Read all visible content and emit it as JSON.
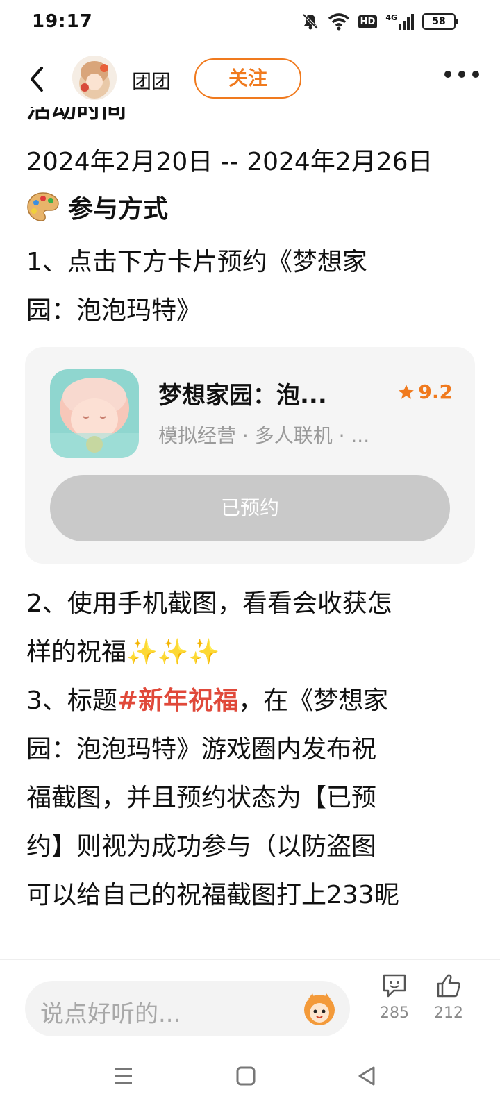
{
  "status_bar": {
    "time": "19:17",
    "battery": "58",
    "network": "4G",
    "hd": "HD"
  },
  "nav": {
    "username": "团团",
    "follow_label": "关注"
  },
  "article": {
    "clipped_heading": "活动时间",
    "date_range": "2024年2月20日 -- 2024年2月26日",
    "section_title": "参与方式",
    "step1_line1": "1、点击下方卡片预约《梦想家",
    "step1_line2": "园：泡泡玛特》",
    "step2_line1": "2、使用手机截图，看看会收获怎",
    "step2_line2": "样的祝福",
    "sparkles": "✨✨✨",
    "step3_prefix": "3、标题",
    "step3_hashtag": "#新年祝福",
    "step3_suffix": "，在《梦想家",
    "step3_line2": "园：泡泡玛特》游戏圈内发布祝",
    "step3_line3": "福截图，并且预约状态为【已预",
    "step3_line4": "约】则视为成功参与（以防盗图",
    "step3_line5": "可以给自己的祝福截图打上233昵"
  },
  "game_card": {
    "title": "梦想家园：泡...",
    "rating": "9.2",
    "tags": "模拟经营 · 多人联机 · ...",
    "reserved_label": "已预约"
  },
  "bottom_bar": {
    "comment_placeholder": "说点好听的...",
    "comment_count": "285",
    "like_count": "212"
  },
  "colors": {
    "accent": "#f07a1e",
    "hashtag": "#e0493a",
    "card_bg": "#f5f5f5",
    "reserved_btn": "#c9c9c9"
  }
}
